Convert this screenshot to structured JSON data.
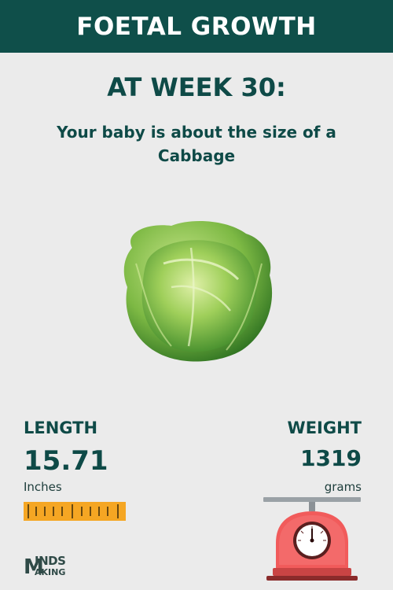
{
  "header": {
    "title": "FOETAL GROWTH"
  },
  "main": {
    "week_heading": "AT WEEK 30:",
    "size_text": "Your baby is about the size of a Cabbage",
    "fruit_icon": "cabbage-icon"
  },
  "length": {
    "label": "LENGTH",
    "value": "15.71",
    "unit": "Inches",
    "icon": "ruler-icon"
  },
  "weight": {
    "label": "WEIGHT",
    "value": "1319",
    "unit": "grams",
    "icon": "scale-icon"
  },
  "brand": {
    "line1": "INDS",
    "line2": "AKING",
    "initial": "M"
  },
  "colors": {
    "header_bg": "#0f4f4a",
    "text": "#0e4a47",
    "background": "#ebebeb",
    "ruler": "#f5a623",
    "scale": "#f15b5b"
  }
}
